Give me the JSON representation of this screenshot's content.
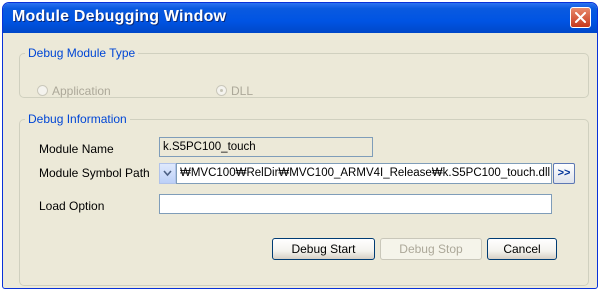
{
  "window": {
    "title": "Module Debugging Window"
  },
  "debug_module_type": {
    "legend": "Debug Module Type",
    "options": [
      {
        "label": "Application",
        "selected": false,
        "enabled": false
      },
      {
        "label": "DLL",
        "selected": true,
        "enabled": false
      }
    ]
  },
  "debug_information": {
    "legend": "Debug Information",
    "module_name_label": "Module Name",
    "module_name_value": "k.S5PC100_touch",
    "symbol_path_label": "Module Symbol Path",
    "symbol_path_value": "₩MVC100₩RelDir₩MVC100_ARMV4I_Release₩k.S5PC100_touch.dll",
    "browse_label": ">>",
    "load_option_label": "Load Option",
    "load_option_value": ""
  },
  "buttons": {
    "debug_start": "Debug Start",
    "debug_stop": "Debug Stop",
    "cancel": "Cancel"
  },
  "icons": {
    "close": "close-icon",
    "dropdown": "chevron-down-icon"
  },
  "colors": {
    "titlebar": "#0054e3",
    "legend": "#0046d5",
    "face": "#ece9d8",
    "close": "#c6381c"
  }
}
